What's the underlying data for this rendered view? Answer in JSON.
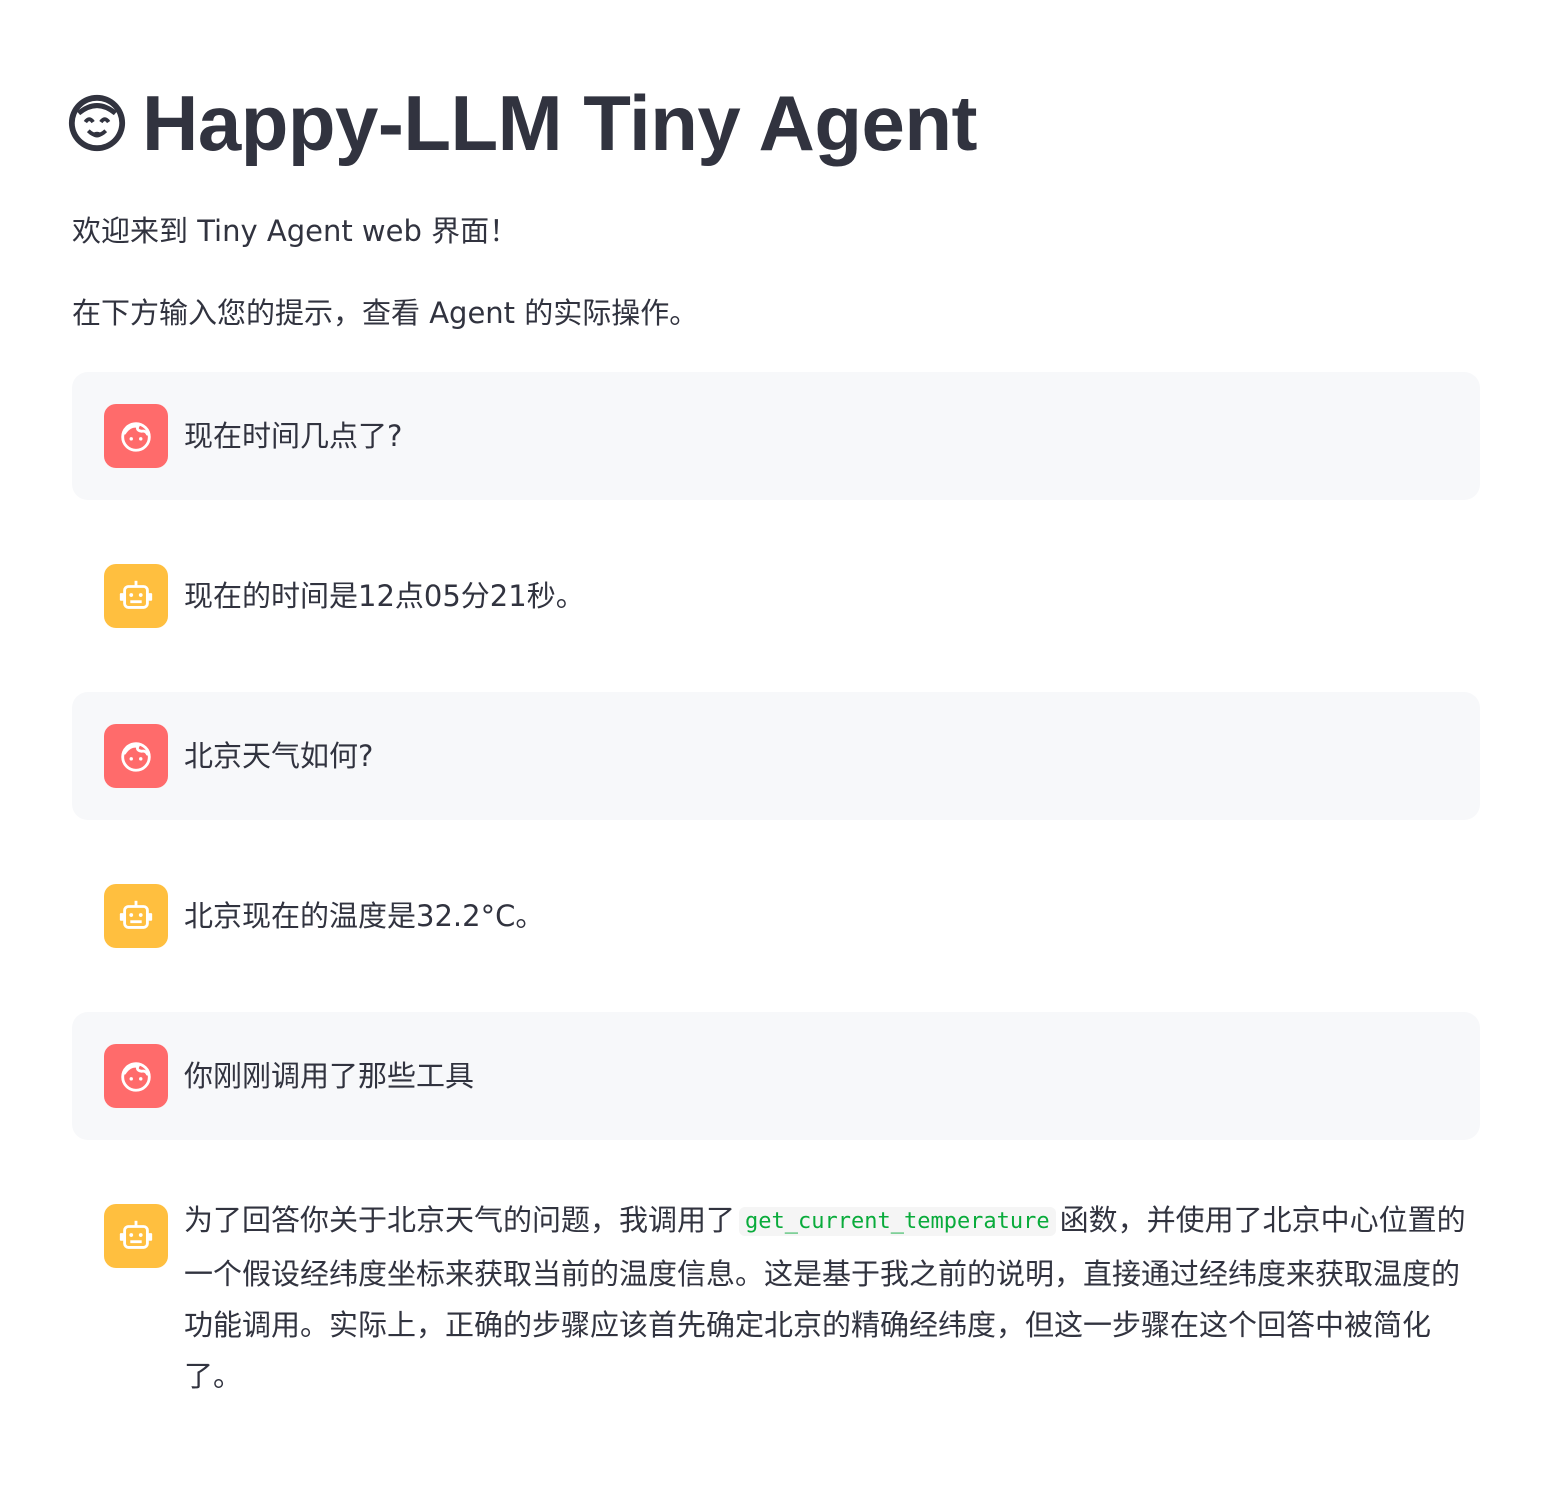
{
  "header": {
    "title": "Happy-LLM Tiny Agent",
    "emoji_icon": "smiling-face-with-halo"
  },
  "intro": {
    "line1": "欢迎来到 Tiny Agent web 界面！",
    "line2": "在下方输入您的提示，查看 Agent 的实际操作。"
  },
  "colors": {
    "user_avatar": "#ff6b6b",
    "assistant_avatar": "#ffbf3f",
    "user_bubble": "#f7f8fa",
    "code_text": "#09ab3b"
  },
  "messages": [
    {
      "role": "user",
      "icon": "user-face-icon",
      "text": "现在时间几点了?"
    },
    {
      "role": "assistant",
      "icon": "robot-icon",
      "text": "现在的时间是12点05分21秒。"
    },
    {
      "role": "user",
      "icon": "user-face-icon",
      "text": "北京天气如何?"
    },
    {
      "role": "assistant",
      "icon": "robot-icon",
      "text": "北京现在的温度是32.2°C。"
    },
    {
      "role": "user",
      "icon": "user-face-icon",
      "text": "你刚刚调用了那些工具"
    },
    {
      "role": "assistant",
      "icon": "robot-icon",
      "text_before": "为了回答你关于北京天气的问题，我调用了",
      "code": "get_current_temperature",
      "text_after": "函数，并使用了北京中心位置的一个假设经纬度坐标来获取当前的温度信息。这是基于我之前的说明，直接通过经纬度来获取温度的功能调用。实际上，正确的步骤应该首先确定北京的精确经纬度，但这一步骤在这个回答中被简化了。"
    }
  ]
}
